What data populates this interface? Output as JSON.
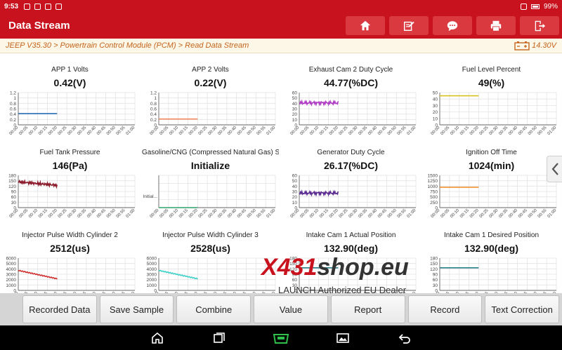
{
  "statusbar": {
    "time": "9:53",
    "battery": "99%"
  },
  "header": {
    "title": "Data Stream",
    "tools": [
      "home-icon",
      "edit-icon",
      "feedback-icon",
      "print-icon",
      "exit-icon"
    ]
  },
  "breadcrumb": {
    "path": "JEEP V35.30 > Powertrain Control Module (PCM) > Read Data Stream",
    "voltage": "14.30V"
  },
  "x_ticks": [
    "00:00",
    "00:05",
    "00:10",
    "00:15",
    "00:20",
    "00:25",
    "00:30",
    "00:35",
    "00:40",
    "00:45",
    "00:50",
    "00:55",
    "01:00"
  ],
  "graphs": [
    {
      "name": "APP 1 Volts",
      "value": "0.42(V)",
      "color": "#2e6fb5",
      "yticks": [
        "1.2",
        "1",
        "0.8",
        "0.6",
        "0.4",
        "0.2",
        "0"
      ],
      "level": 0.35,
      "kind": "flat"
    },
    {
      "name": "APP 2 Volts",
      "value": "0.22(V)",
      "color": "#f08a5d",
      "yticks": [
        "1.2",
        "1",
        "0.8",
        "0.6",
        "0.4",
        "0.2",
        "0"
      ],
      "level": 0.18,
      "kind": "flat"
    },
    {
      "name": "Exhaust Cam 2 Duty Cycle",
      "value": "44.77(%DC)",
      "color": "#b13fc6",
      "yticks": [
        "60",
        "50",
        "40",
        "30",
        "20",
        "10",
        "0"
      ],
      "level": 0.68,
      "kind": "noisy"
    },
    {
      "name": "Fuel Level Percent",
      "value": "49(%)",
      "color": "#d6c21b",
      "yticks": [
        "50",
        "40",
        "30",
        "20",
        "10",
        "0"
      ],
      "level": 0.9,
      "kind": "flat"
    },
    {
      "name": "Fuel Tank Pressure",
      "value": "146(Pa)",
      "color": "#8b1a2b",
      "yticks": [
        "180",
        "150",
        "120",
        "90",
        "60",
        "30",
        "0"
      ],
      "level": 0.8,
      "kind": "noisy-down"
    },
    {
      "name": "Gasoline/CNG (Compressed Natural Gas) S...",
      "value": "Initialize",
      "color": "#2fa36b",
      "yticks": [],
      "label_y": "Initial...",
      "level": 0.0,
      "kind": "flat"
    },
    {
      "name": "Generator Duty Cycle",
      "value": "26.17(%DC)",
      "color": "#5b2d91",
      "yticks": [
        "60",
        "50",
        "40",
        "30",
        "20",
        "10",
        "0"
      ],
      "level": 0.45,
      "kind": "noisy"
    },
    {
      "name": "Ignition Off Time",
      "value": "1024(min)",
      "color": "#f08a1e",
      "yticks": [
        "1500",
        "1250",
        "1000",
        "750",
        "500",
        "250",
        "0"
      ],
      "level": 0.63,
      "kind": "flat"
    },
    {
      "name": "Injector Pulse Width Cylinder 2",
      "value": "2512(us)",
      "color": "#d03030",
      "yticks": [
        "6000",
        "5000",
        "4000",
        "3000",
        "2000",
        "1000",
        "0"
      ],
      "level": 0.62,
      "kind": "down"
    },
    {
      "name": "Injector Pulse Width Cylinder 3",
      "value": "2528(us)",
      "color": "#3fd1c8",
      "yticks": [
        "6000",
        "5000",
        "4000",
        "3000",
        "2000",
        "1000",
        "0"
      ],
      "level": 0.62,
      "kind": "down"
    },
    {
      "name": "Intake Cam 1 Actual Position",
      "value": "132.90(deg)",
      "color": "#2b7f86",
      "yticks": [
        "180",
        "150",
        "120",
        "90",
        "60",
        "30",
        "0"
      ],
      "level": 0.7,
      "kind": "flat"
    },
    {
      "name": "Intake Cam 1 Desired Position",
      "value": "132.90(deg)",
      "color": "#2b7f86",
      "yticks": [
        "180",
        "150",
        "120",
        "90",
        "60",
        "30",
        "0"
      ],
      "level": 0.7,
      "kind": "flat"
    }
  ],
  "watermark": {
    "logo_red": "X431",
    "logo_dark": "shop.eu",
    "dealer": "LAUNCH Authorized EU Dealer"
  },
  "buttons": [
    "Recorded Data",
    "Save Sample",
    "Combine",
    "Value",
    "Report",
    "Record",
    "Text Correction"
  ],
  "navbar": [
    "home-icon",
    "recent-apps-icon",
    "vci-icon",
    "gallery-icon",
    "back-icon"
  ]
}
